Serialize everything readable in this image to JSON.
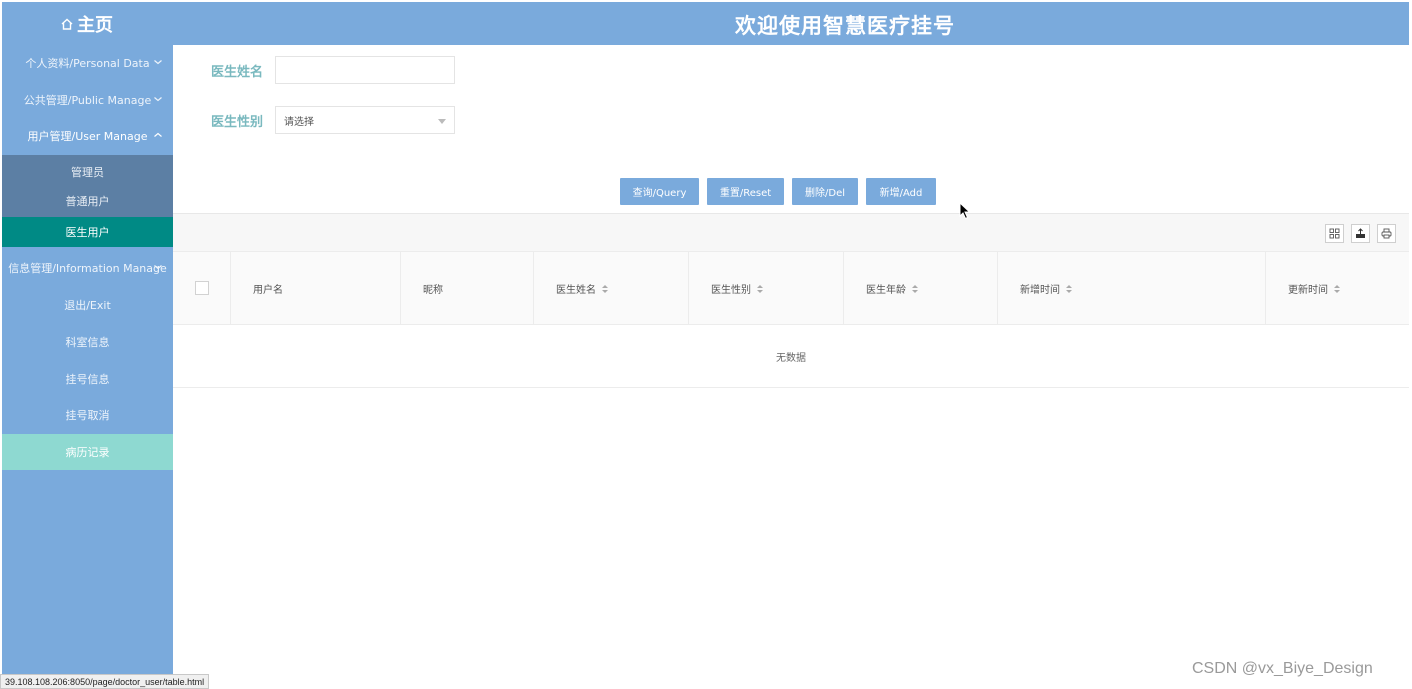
{
  "header": {
    "home_label": "主页",
    "title": "欢迎使用智慧医疗挂号"
  },
  "sidebar": {
    "items": [
      {
        "label": "个人资料/Personal Data"
      },
      {
        "label": "公共管理/Public Manage"
      },
      {
        "label": "用户管理/User Manage"
      },
      {
        "label": "信息管理/Information Manage"
      },
      {
        "label": "退出/Exit"
      },
      {
        "label": "科室信息"
      },
      {
        "label": "挂号信息"
      },
      {
        "label": "挂号取消"
      },
      {
        "label": "病历记录"
      }
    ],
    "submenu": [
      {
        "label": "管理员"
      },
      {
        "label": "普通用户"
      },
      {
        "label": "医生用户",
        "active": true
      }
    ]
  },
  "search": {
    "name_label": "医生姓名",
    "name_value": "",
    "gender_label": "医生性别",
    "gender_selected": "请选择"
  },
  "actions": {
    "query": "查询/Query",
    "reset": "重置/Reset",
    "delete": "删除/Del",
    "add": "新增/Add"
  },
  "table": {
    "columns": [
      {
        "label": "用户名",
        "sortable": false
      },
      {
        "label": "昵称",
        "sortable": false
      },
      {
        "label": "医生姓名",
        "sortable": true
      },
      {
        "label": "医生性别",
        "sortable": true
      },
      {
        "label": "医生年龄",
        "sortable": true
      },
      {
        "label": "新增时间",
        "sortable": true
      },
      {
        "label": "更新时间",
        "sortable": true
      }
    ],
    "empty_text": "无数据"
  },
  "statusbar": {
    "url": "39.108.108.206:8050/page/doctor_user/table.html"
  },
  "watermark": "CSDN @vx_Biye_Design",
  "colors": {
    "primary": "#7aaadc",
    "active_submenu": "#008a85",
    "highlight_item": "#8ed9d1",
    "label_teal": "#7ab9bf"
  }
}
